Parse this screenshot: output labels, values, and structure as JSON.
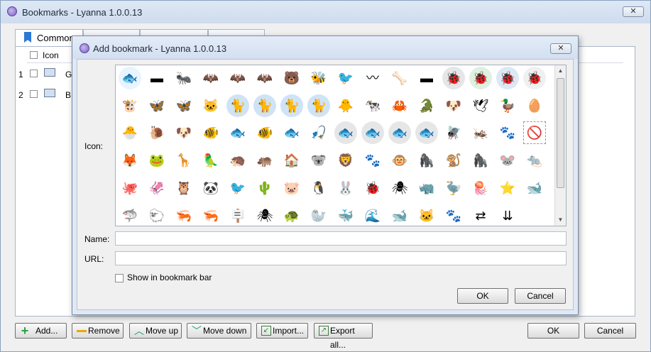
{
  "main_window": {
    "title": "Bookmarks - Lyanna 1.0.0.13",
    "close_label": "✕",
    "tabs": [
      {
        "label": "Common"
      },
      {
        "label": ""
      },
      {
        "label": ""
      },
      {
        "label": ""
      }
    ],
    "list": {
      "header_icon_label": "Icon",
      "rows": [
        {
          "num": "1",
          "name_partial": "G"
        },
        {
          "num": "2",
          "name_partial": "B"
        }
      ]
    },
    "buttons": {
      "add": "Add...",
      "remove": "Remove",
      "move_up": "Move up",
      "move_down": "Move down",
      "import": "Import...",
      "export_all": "Export all...",
      "ok": "OK",
      "cancel": "Cancel"
    }
  },
  "dialog": {
    "title": "Add bookmark - Lyanna 1.0.0.13",
    "close_label": "✕",
    "icon_label": "Icon:",
    "name_label": "Name:",
    "url_label": "URL:",
    "name_value": "",
    "url_value": "",
    "show_in_bar_label": "Show in bookmark bar",
    "ok_label": "OK",
    "cancel_label": "Cancel",
    "icons": [
      {
        "name": "fishbowl",
        "glyph": "🐟",
        "bg": "#e8f4ff"
      },
      {
        "name": "animal-tray",
        "glyph": "▬",
        "bg": "#ffffff"
      },
      {
        "name": "ant",
        "glyph": "🐜",
        "bg": "#ffffff"
      },
      {
        "name": "bat",
        "glyph": "🦇",
        "bg": "#ffffff"
      },
      {
        "name": "bat-2",
        "glyph": "🦇",
        "bg": "#ffffff"
      },
      {
        "name": "bat-sleep",
        "glyph": "🦇",
        "bg": "#ffffff"
      },
      {
        "name": "bear",
        "glyph": "🐻",
        "bg": "#ffffff"
      },
      {
        "name": "bee",
        "glyph": "🐝",
        "bg": "#ffffff"
      },
      {
        "name": "bird",
        "glyph": "🐦",
        "bg": "#ffffff"
      },
      {
        "name": "birds",
        "glyph": "〰",
        "bg": "#ffffff"
      },
      {
        "name": "bone",
        "glyph": "🦴",
        "bg": "#ffffff"
      },
      {
        "name": "bowl",
        "glyph": "▬",
        "bg": "#ffffff"
      },
      {
        "name": "bug",
        "glyph": "🐞",
        "bg": "#e6e6e6"
      },
      {
        "name": "bug-add",
        "glyph": "🐞",
        "bg": "#dff0e0"
      },
      {
        "name": "bug-ok",
        "glyph": "🐞",
        "bg": "#dde8f5"
      },
      {
        "name": "bug-delete",
        "glyph": "🐞",
        "bg": "#f0f0f0"
      },
      {
        "name": "bull",
        "glyph": "🐮",
        "bg": "#ffffff"
      },
      {
        "name": "butterfly",
        "glyph": "🦋",
        "bg": "#ffffff"
      },
      {
        "name": "butterfly-2",
        "glyph": "🦋",
        "bg": "#ffffff"
      },
      {
        "name": "cat",
        "glyph": "🐱",
        "bg": "#ffffff"
      },
      {
        "name": "cat-silhouette",
        "glyph": "🐈",
        "bg": "#cfe3f7"
      },
      {
        "name": "cat-add",
        "glyph": "🐈",
        "bg": "#cfe3f7"
      },
      {
        "name": "cat-ok",
        "glyph": "🐈",
        "bg": "#cfe3f7"
      },
      {
        "name": "cat-delete",
        "glyph": "🐈",
        "bg": "#cfe3f7"
      },
      {
        "name": "chick",
        "glyph": "🐥",
        "bg": "#ffffff"
      },
      {
        "name": "cow",
        "glyph": "🐄",
        "bg": "#ffffff"
      },
      {
        "name": "crab",
        "glyph": "🦀",
        "bg": "#ffffff"
      },
      {
        "name": "crocodile",
        "glyph": "🐊",
        "bg": "#ffffff"
      },
      {
        "name": "dog",
        "glyph": "🐶",
        "bg": "#ffffff"
      },
      {
        "name": "dove",
        "glyph": "🕊",
        "bg": "#ffffff"
      },
      {
        "name": "duck",
        "glyph": "🦆",
        "bg": "#ffffff"
      },
      {
        "name": "egg",
        "glyph": "🥚",
        "bg": "#ffffff"
      },
      {
        "name": "hatching-chick",
        "glyph": "🐣",
        "bg": "#ffffff"
      },
      {
        "name": "snail",
        "glyph": "🐌",
        "bg": "#ffffff"
      },
      {
        "name": "pug",
        "glyph": "🐶",
        "bg": "#ffffff"
      },
      {
        "name": "fish-orange",
        "glyph": "🐠",
        "bg": "#ffffff"
      },
      {
        "name": "fish-green",
        "glyph": "🐟",
        "bg": "#ffffff"
      },
      {
        "name": "tropical-fish",
        "glyph": "🐠",
        "bg": "#ffffff"
      },
      {
        "name": "fishes",
        "glyph": "🐟",
        "bg": "#ffffff"
      },
      {
        "name": "fishing-hook",
        "glyph": "🎣",
        "bg": "#ffffff"
      },
      {
        "name": "fish-gray",
        "glyph": "🐟",
        "bg": "#e6e6e6"
      },
      {
        "name": "fish-add",
        "glyph": "🐟",
        "bg": "#e6e6e6"
      },
      {
        "name": "fish-ok",
        "glyph": "🐟",
        "bg": "#e6e6e6"
      },
      {
        "name": "fish-delete",
        "glyph": "🐟",
        "bg": "#e6e6e6"
      },
      {
        "name": "dragonfly",
        "glyph": "🪰",
        "bg": "#ffffff"
      },
      {
        "name": "cicada",
        "glyph": "🦗",
        "bg": "#ffffff"
      },
      {
        "name": "paw",
        "glyph": "🐾",
        "bg": "#ffffff"
      },
      {
        "name": "no-pets",
        "glyph": "🚫",
        "bg": "#ffffff"
      },
      {
        "name": "fox",
        "glyph": "🦊",
        "bg": "#ffffff"
      },
      {
        "name": "frog",
        "glyph": "🐸",
        "bg": "#ffffff"
      },
      {
        "name": "giraffe",
        "glyph": "🦒",
        "bg": "#ffffff"
      },
      {
        "name": "parrot",
        "glyph": "🦜",
        "bg": "#ffffff"
      },
      {
        "name": "hedgehog",
        "glyph": "🦔",
        "bg": "#ffffff"
      },
      {
        "name": "hippo",
        "glyph": "🦛",
        "bg": "#ffffff"
      },
      {
        "name": "kennel",
        "glyph": "🏠",
        "bg": "#ffffff"
      },
      {
        "name": "koala",
        "glyph": "🐨",
        "bg": "#ffffff"
      },
      {
        "name": "lion",
        "glyph": "🦁",
        "bg": "#ffffff"
      },
      {
        "name": "lost-pet",
        "glyph": "🐾",
        "bg": "#ffffff"
      },
      {
        "name": "monkey",
        "glyph": "🐵",
        "bg": "#ffffff"
      },
      {
        "name": "gorilla",
        "glyph": "🦍",
        "bg": "#ffffff"
      },
      {
        "name": "monkey-2",
        "glyph": "🐒",
        "bg": "#ffffff"
      },
      {
        "name": "gorilla-2",
        "glyph": "🦍",
        "bg": "#ffffff"
      },
      {
        "name": "mouse",
        "glyph": "🐭",
        "bg": "#ffffff"
      },
      {
        "name": "rat",
        "glyph": "🐀",
        "bg": "#ffffff"
      },
      {
        "name": "octopus",
        "glyph": "🐙",
        "bg": "#ffffff"
      },
      {
        "name": "squid",
        "glyph": "🦑",
        "bg": "#ffffff"
      },
      {
        "name": "owl",
        "glyph": "🦉",
        "bg": "#ffffff"
      },
      {
        "name": "panda",
        "glyph": "🐼",
        "bg": "#ffffff"
      },
      {
        "name": "toucan",
        "glyph": "🐦",
        "bg": "#ffffff"
      },
      {
        "name": "cactus-bird",
        "glyph": "🌵",
        "bg": "#ffffff"
      },
      {
        "name": "pig",
        "glyph": "🐷",
        "bg": "#ffffff"
      },
      {
        "name": "penguin",
        "glyph": "🐧",
        "bg": "#ffffff"
      },
      {
        "name": "rabbit",
        "glyph": "🐰",
        "bg": "#ffffff"
      },
      {
        "name": "ladybug",
        "glyph": "🐞",
        "bg": "#ffffff"
      },
      {
        "name": "spider",
        "glyph": "🕷",
        "bg": "#ffffff"
      },
      {
        "name": "rhino",
        "glyph": "🦏",
        "bg": "#ffffff"
      },
      {
        "name": "pelican",
        "glyph": "🦤",
        "bg": "#ffffff"
      },
      {
        "name": "jellyfish",
        "glyph": "🪼",
        "bg": "#ffffff"
      },
      {
        "name": "starfish",
        "glyph": "⭐",
        "bg": "#ffffff"
      },
      {
        "name": "orca",
        "glyph": "🐋",
        "bg": "#ffffff"
      },
      {
        "name": "shark-fin",
        "glyph": "🦈",
        "bg": "#ffffff"
      },
      {
        "name": "sheep",
        "glyph": "🐑",
        "bg": "#ffffff"
      },
      {
        "name": "shrimp",
        "glyph": "🦐",
        "bg": "#ffffff"
      },
      {
        "name": "shrimp-2",
        "glyph": "🦐",
        "bg": "#ffffff"
      },
      {
        "name": "signpost",
        "glyph": "🪧",
        "bg": "#ffffff"
      },
      {
        "name": "spider-pink",
        "glyph": "🕷",
        "bg": "#ffffff"
      },
      {
        "name": "turtle",
        "glyph": "🐢",
        "bg": "#ffffff"
      },
      {
        "name": "walrus",
        "glyph": "🦭",
        "bg": "#ffffff"
      },
      {
        "name": "whale",
        "glyph": "🐳",
        "bg": "#ffffff"
      },
      {
        "name": "water-waves",
        "glyph": "🌊",
        "bg": "#ffffff"
      },
      {
        "name": "whale-tail",
        "glyph": "🐋",
        "bg": "#ffffff"
      },
      {
        "name": "cat-white",
        "glyph": "🐱",
        "bg": "#ffffff"
      },
      {
        "name": "zoo",
        "glyph": "🐾",
        "bg": "#ffffff"
      },
      {
        "name": "swap-arrows",
        "glyph": "⇄",
        "bg": "#ffffff"
      },
      {
        "name": "down-arrows",
        "glyph": "⇊",
        "bg": "#ffffff"
      }
    ]
  }
}
